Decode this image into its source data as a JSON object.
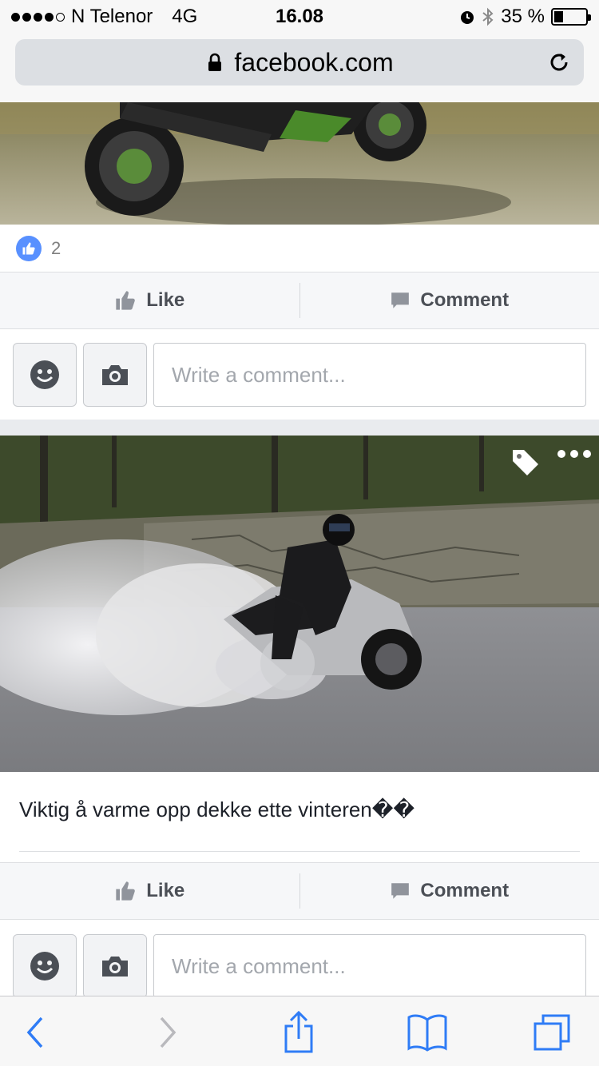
{
  "status_bar": {
    "carrier": "N Telenor",
    "network": "4G",
    "time": "16.08",
    "battery": "35 %",
    "battery_level": 0.35,
    "signal_bars": 4,
    "signal_total": 5
  },
  "browser": {
    "url": "facebook.com"
  },
  "post1": {
    "like_count": "2",
    "like_label": "Like",
    "comment_label": "Comment",
    "comment_placeholder": "Write a comment..."
  },
  "post2": {
    "caption": "Viktig å varme opp dekke ette vinteren��",
    "like_label": "Like",
    "comment_label": "Comment",
    "comment_placeholder": "Write a comment..."
  },
  "colors": {
    "facebook_blue": "#5890ff",
    "ios_blue": "#2f7cf6",
    "action_text": "#4b4f56"
  },
  "icons": {
    "lock": "lock-icon",
    "reload": "reload-icon",
    "thumbs_up": "thumbs-up-icon",
    "comment": "comment-icon",
    "emoji": "smiley-icon",
    "camera": "camera-icon",
    "tag": "tag-icon",
    "more": "more-icon",
    "back": "chevron-left-icon",
    "forward": "chevron-right-icon",
    "share": "share-icon",
    "bookmarks": "book-icon",
    "tabs": "tabs-icon"
  }
}
